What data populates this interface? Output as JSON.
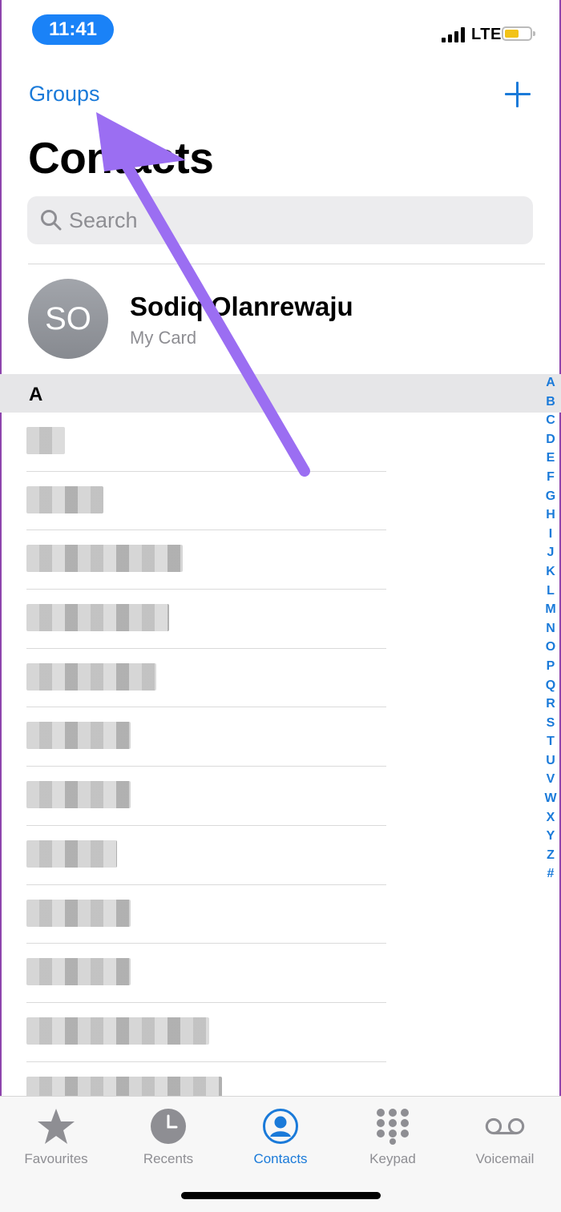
{
  "status": {
    "time": "11:41",
    "network": "LTE"
  },
  "nav": {
    "groups_label": "Groups",
    "add_icon": "plus-icon"
  },
  "header": {
    "title": "Contacts"
  },
  "search": {
    "placeholder": "Search"
  },
  "my_card": {
    "initials": "SO",
    "name": "Sodiq Olanrewaju",
    "subtitle": "My Card"
  },
  "section": {
    "letter": "A"
  },
  "contacts": {
    "rows_count_note": "blurred",
    "row_widths": [
      48,
      96,
      195,
      178,
      162,
      130,
      130,
      113,
      130,
      130,
      228,
      244
    ]
  },
  "index": [
    "A",
    "B",
    "C",
    "D",
    "E",
    "F",
    "G",
    "H",
    "I",
    "J",
    "K",
    "L",
    "M",
    "N",
    "O",
    "P",
    "Q",
    "R",
    "S",
    "T",
    "U",
    "V",
    "W",
    "X",
    "Y",
    "Z",
    "#"
  ],
  "tabs": [
    {
      "label": "Favourites",
      "icon": "star-icon"
    },
    {
      "label": "Recents",
      "icon": "clock-icon"
    },
    {
      "label": "Contacts",
      "icon": "person-icon"
    },
    {
      "label": "Keypad",
      "icon": "keypad-icon"
    },
    {
      "label": "Voicemail",
      "icon": "voicemail-icon"
    }
  ],
  "colors": {
    "accent": "#1a7ad9",
    "annotation_arrow": "#9b6ef2",
    "battery": "#f2c318"
  }
}
